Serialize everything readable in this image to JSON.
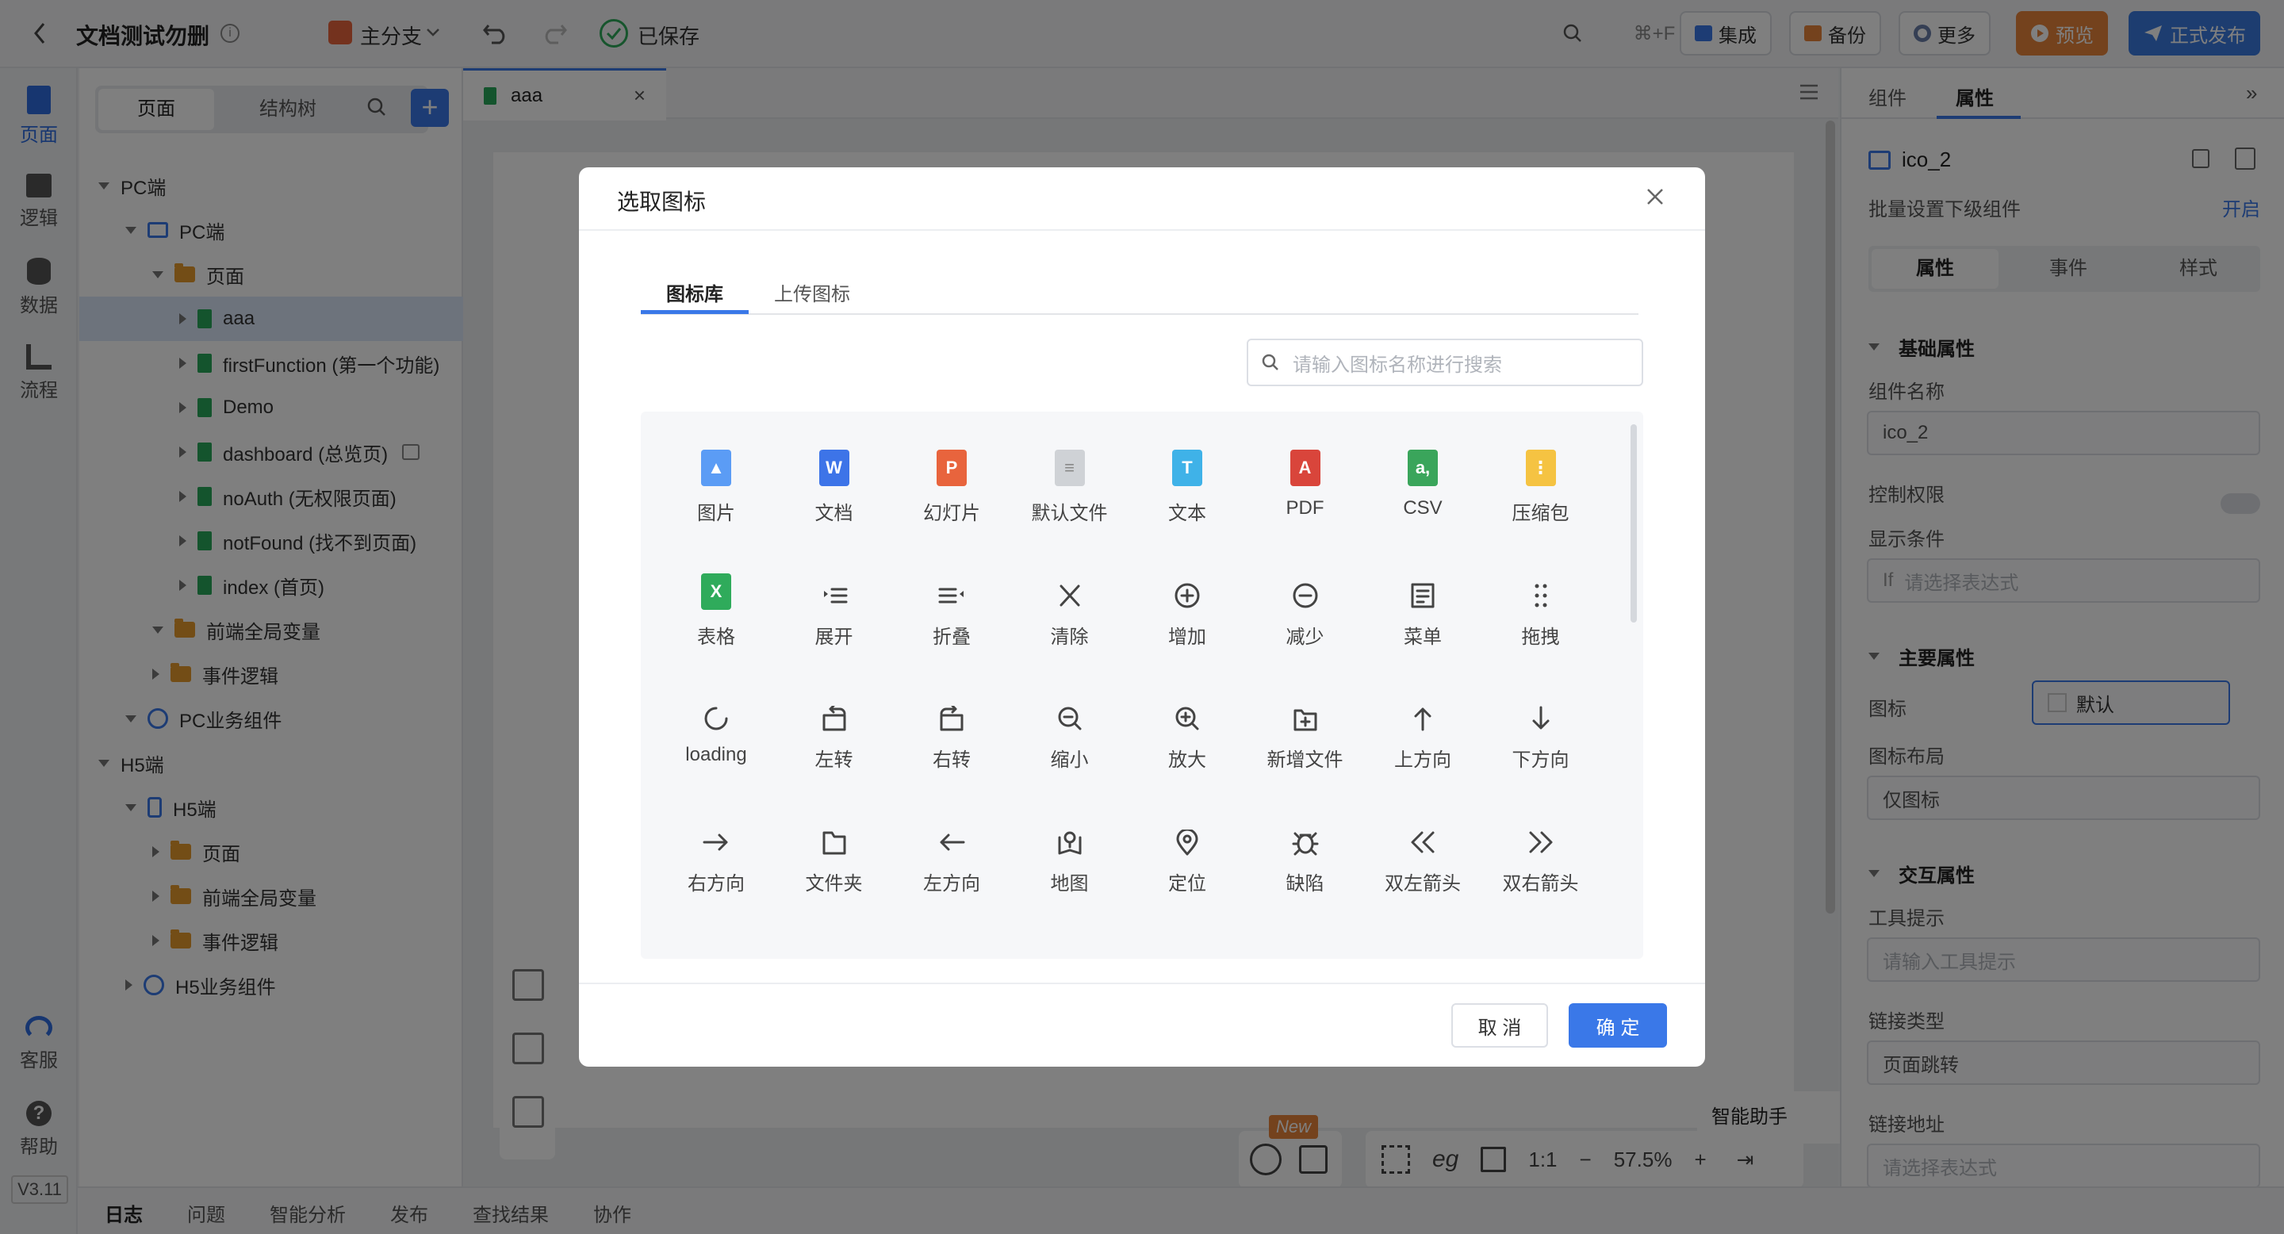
{
  "topbar": {
    "back": "<",
    "title": "文档测试勿删",
    "branch": "主分支",
    "saved": "已保存",
    "search_shortcut": "⌘+F",
    "integrate": "集成",
    "backup": "备份",
    "more": "更多",
    "preview": "预览",
    "publish": "正式发布"
  },
  "rail": {
    "items": [
      "页面",
      "逻辑",
      "数据",
      "流程"
    ],
    "support": "客服",
    "help": "帮助",
    "version": "V3.11"
  },
  "tree": {
    "tabs": [
      "页面",
      "结构树"
    ],
    "add": "+",
    "rows": [
      {
        "label": "PC端"
      },
      {
        "label": "PC端"
      },
      {
        "label": "页面"
      },
      {
        "label": "aaa"
      },
      {
        "label": "firstFunction (第一个功能)"
      },
      {
        "label": "Demo"
      },
      {
        "label": "dashboard (总览页)"
      },
      {
        "label": "noAuth (无权限页面)"
      },
      {
        "label": "notFound (找不到页面)"
      },
      {
        "label": "index (首页)"
      },
      {
        "label": "前端全局变量"
      },
      {
        "label": "事件逻辑"
      },
      {
        "label": "PC业务组件"
      },
      {
        "label": "H5端"
      },
      {
        "label": "H5端"
      },
      {
        "label": "页面"
      },
      {
        "label": "前端全局变量"
      },
      {
        "label": "事件逻辑"
      },
      {
        "label": "H5业务组件"
      }
    ]
  },
  "editor": {
    "tab": "aaa",
    "ai_helper": "智能助手",
    "new_badge": "New",
    "ratio": "1:1",
    "zoom": "57.5%",
    "minus": "−",
    "plus": "+"
  },
  "right": {
    "tabs": [
      "组件",
      "属性"
    ],
    "component": "ico_2",
    "batch": "批量设置下级组件",
    "batch_on": "开启",
    "subtabs": [
      "属性",
      "事件",
      "样式"
    ],
    "basic": "基础属性",
    "name_label": "组件名称",
    "name_value": "ico_2",
    "perm_label": "控制权限",
    "cond_label": "显示条件",
    "cond_ph": "请选择表达式",
    "cond_prefix": "If",
    "main": "主要属性",
    "icon_label": "图标",
    "icon_value": "默认",
    "layout_label": "图标布局",
    "layout_value": "仅图标",
    "interact": "交互属性",
    "tooltip_label": "工具提示",
    "tooltip_ph": "请输入工具提示",
    "link_type_label": "链接类型",
    "link_type_value": "页面跳转",
    "link_addr_label": "链接地址",
    "link_addr_ph": "请选择表达式"
  },
  "bottom": {
    "tabs": [
      "日志",
      "问题",
      "智能分析",
      "发布",
      "查找结果",
      "协作"
    ]
  },
  "modal": {
    "title": "选取图标",
    "tabs": [
      "图标库",
      "上传图标"
    ],
    "search_ph": "请输入图标名称进行搜索",
    "icons": [
      {
        "name": "图片",
        "icon": "image-file-icon",
        "color": "#5b9cf5"
      },
      {
        "name": "文档",
        "icon": "word-file-icon",
        "color": "#3d74e8"
      },
      {
        "name": "幻灯片",
        "icon": "ppt-file-icon",
        "color": "#e8643d"
      },
      {
        "name": "默认文件",
        "icon": "default-file-icon",
        "color": "#cfd2d6"
      },
      {
        "name": "文本",
        "icon": "text-file-icon",
        "color": "#3fb2e8"
      },
      {
        "name": "PDF",
        "icon": "pdf-file-icon",
        "color": "#d9453b"
      },
      {
        "name": "CSV",
        "icon": "csv-file-icon",
        "color": "#3aa55b"
      },
      {
        "name": "压缩包",
        "icon": "zip-file-icon",
        "color": "#f5c342"
      },
      {
        "name": "表格",
        "icon": "excel-file-icon",
        "color": "#2fab5b"
      },
      {
        "name": "展开",
        "icon": "expand-icon"
      },
      {
        "name": "折叠",
        "icon": "collapse-icon"
      },
      {
        "name": "清除",
        "icon": "clear-icon"
      },
      {
        "name": "增加",
        "icon": "plus-circle-icon"
      },
      {
        "name": "减少",
        "icon": "minus-circle-icon"
      },
      {
        "name": "菜单",
        "icon": "menu-icon"
      },
      {
        "name": "拖拽",
        "icon": "drag-icon"
      },
      {
        "name": "loading",
        "icon": "loading-icon"
      },
      {
        "name": "左转",
        "icon": "rotate-left-icon"
      },
      {
        "name": "右转",
        "icon": "rotate-right-icon"
      },
      {
        "name": "缩小",
        "icon": "zoom-out-icon"
      },
      {
        "name": "放大",
        "icon": "zoom-in-icon"
      },
      {
        "name": "新增文件",
        "icon": "new-file-icon"
      },
      {
        "name": "上方向",
        "icon": "arrow-up-icon"
      },
      {
        "name": "下方向",
        "icon": "arrow-down-icon"
      },
      {
        "name": "右方向",
        "icon": "arrow-right-icon"
      },
      {
        "name": "文件夹",
        "icon": "folder-icon"
      },
      {
        "name": "左方向",
        "icon": "arrow-left-icon"
      },
      {
        "name": "地图",
        "icon": "map-icon"
      },
      {
        "name": "定位",
        "icon": "location-icon"
      },
      {
        "name": "缺陷",
        "icon": "bug-icon"
      },
      {
        "name": "双左箭头",
        "icon": "double-left-icon"
      },
      {
        "name": "双右箭头",
        "icon": "double-right-icon"
      }
    ],
    "cancel": "取 消",
    "ok": "确 定"
  },
  "colors": {
    "primary": "#3a78e8",
    "orange": "#e8843a",
    "publish": "#3a7be0"
  }
}
